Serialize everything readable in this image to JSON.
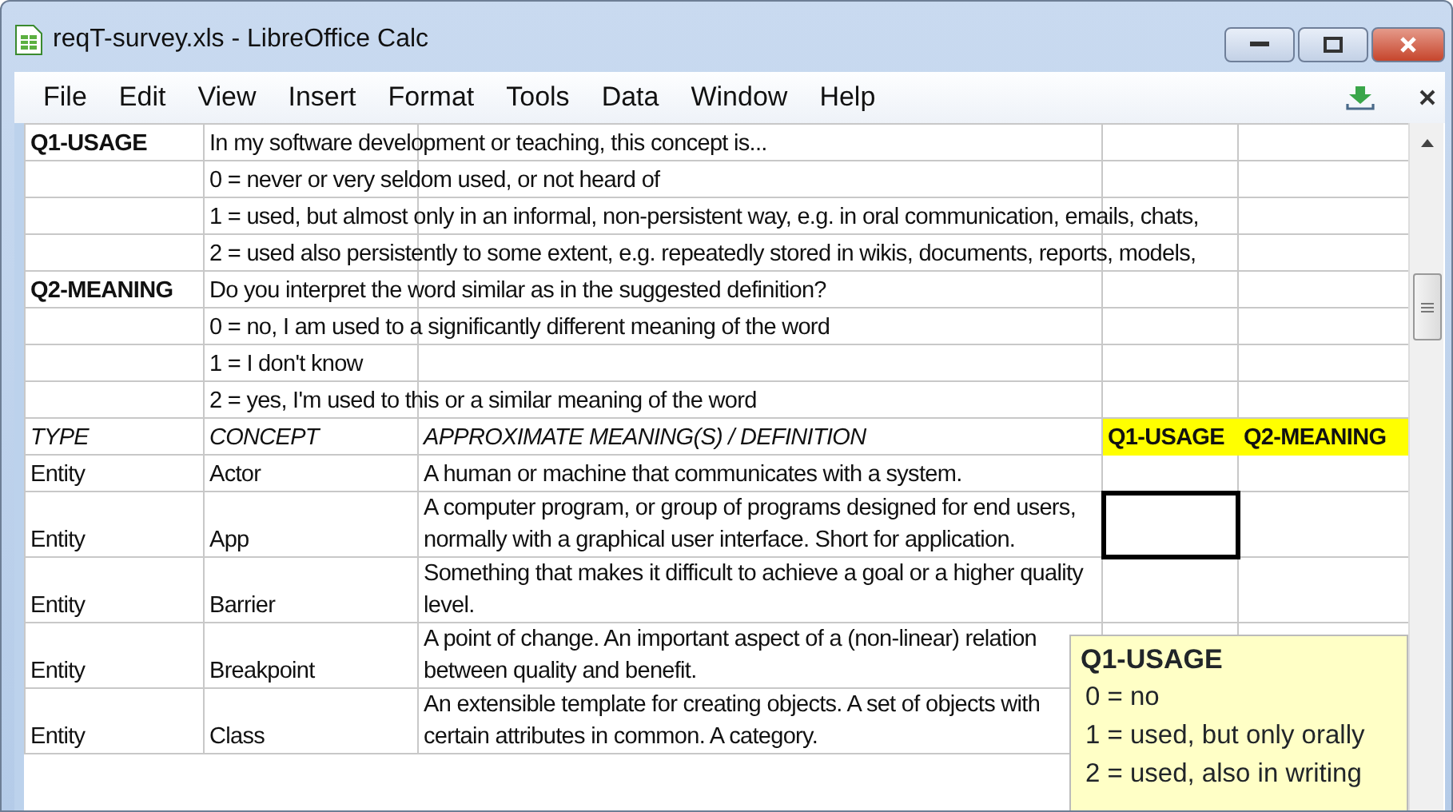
{
  "window": {
    "title": "reqT-survey.xls - LibreOffice Calc"
  },
  "menu": [
    "File",
    "Edit",
    "View",
    "Insert",
    "Format",
    "Tools",
    "Data",
    "Window",
    "Help"
  ],
  "sheet": {
    "rows": [
      {
        "kind": "intro",
        "label": "Q1-USAGE",
        "text": "In my software development or teaching, this concept is..."
      },
      {
        "kind": "intro",
        "text": "0 = never or very seldom used, or not heard of"
      },
      {
        "kind": "intro",
        "text": "1 = used, but almost only in an informal, non-persistent way, e.g. in oral communication, emails, chats,"
      },
      {
        "kind": "intro",
        "text": "2 = used also persistently to some extent, e.g. repeatedly stored in wikis, documents, reports, models,"
      },
      {
        "kind": "intro",
        "label": "Q2-MEANING",
        "text": "Do you interpret the word similar as in the suggested definition?"
      },
      {
        "kind": "intro",
        "text": "0 = no, I am used to a significantly different meaning of the word"
      },
      {
        "kind": "intro",
        "text": "1 = I don't know"
      },
      {
        "kind": "intro",
        "text": "2 = yes, I'm used to this or a similar meaning of the word"
      },
      {
        "kind": "header",
        "columns": [
          "TYPE",
          "CONCEPT",
          "APPROXIMATE MEANING(S) / DEFINITION",
          "Q1-USAGE",
          "Q2-MEANING"
        ]
      },
      {
        "kind": "entry",
        "type": "Entity",
        "concept": "Actor",
        "definition": "A human or machine that communicates with a system.",
        "selected": false
      },
      {
        "kind": "entry",
        "type": "Entity",
        "concept": "App",
        "definition": "A computer program, or group of programs designed for end users, normally with a graphical user interface. Short for application.",
        "selected": true
      },
      {
        "kind": "entry",
        "type": "Entity",
        "concept": "Barrier",
        "definition": "Something that makes it difficult to achieve a goal or a higher quality level.",
        "selected": false
      },
      {
        "kind": "entry",
        "type": "Entity",
        "concept": "Breakpoint",
        "definition": "A point of change. An important aspect of a (non-linear) relation between quality and benefit.",
        "selected": false
      },
      {
        "kind": "entry",
        "type": "Entity",
        "concept": "Class",
        "definition": "An extensible template for creating objects. A set of objects with certain attributes in common. A category."
      }
    ]
  },
  "comment": {
    "title": "Q1-USAGE",
    "lines": [
      "0 = no",
      "1 = used, but only orally",
      "2 = used, also in writing"
    ]
  }
}
